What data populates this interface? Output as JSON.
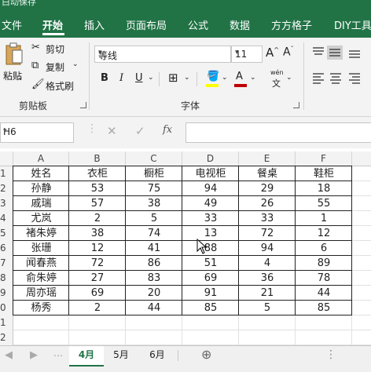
{
  "window": {
    "title_fragment": "白动保存"
  },
  "tabs": [
    "文件",
    "开始",
    "插入",
    "页面布局",
    "公式",
    "数据",
    "方方格子",
    "DIY工具"
  ],
  "active_tab": "开始",
  "ribbon": {
    "clipboard": {
      "paste": "粘贴",
      "cut": "剪切",
      "copy": "复制",
      "format_painter": "格式刷",
      "group": "剪贴板"
    },
    "font": {
      "font_name": "等线",
      "font_size": "11",
      "bold": "B",
      "italic": "I",
      "underline": "U",
      "font_color": "A",
      "wen_top": "wén",
      "wen": "文",
      "group": "字体"
    }
  },
  "formula_bar": {
    "name_box": "H6",
    "fx": "fx",
    "content": ""
  },
  "columns": [
    "A",
    "B",
    "C",
    "D",
    "E",
    "F"
  ],
  "row_numbers": [
    "1",
    "2",
    "3",
    "4",
    "5",
    "6",
    "7",
    "8",
    "9",
    "0",
    "1",
    "2"
  ],
  "header_row": [
    "姓名",
    "衣柜",
    "橱柜",
    "电视柜",
    "餐桌",
    "鞋柜"
  ],
  "rows": [
    [
      "孙静",
      "53",
      "75",
      "94",
      "29",
      "18"
    ],
    [
      "戚瑞",
      "57",
      "38",
      "49",
      "26",
      "55"
    ],
    [
      "尤岚",
      "2",
      "5",
      "33",
      "33",
      "1"
    ],
    [
      "褚朱婷",
      "38",
      "74",
      "13",
      "72",
      "12"
    ],
    [
      "张珊",
      "12",
      "41",
      "88",
      "94",
      "6"
    ],
    [
      "闻春燕",
      "72",
      "86",
      "51",
      "4",
      "89"
    ],
    [
      "俞朱婷",
      "27",
      "83",
      "69",
      "36",
      "78"
    ],
    [
      "周亦瑶",
      "69",
      "20",
      "91",
      "21",
      "44"
    ],
    [
      "杨秀",
      "2",
      "44",
      "85",
      "5",
      "85"
    ]
  ],
  "sheets": [
    "4月",
    "5月",
    "6月"
  ],
  "active_sheet": "4月",
  "colors": {
    "accent": "#217346",
    "underline_red": "#c00000",
    "highlight_yellow": "#ffff00"
  }
}
